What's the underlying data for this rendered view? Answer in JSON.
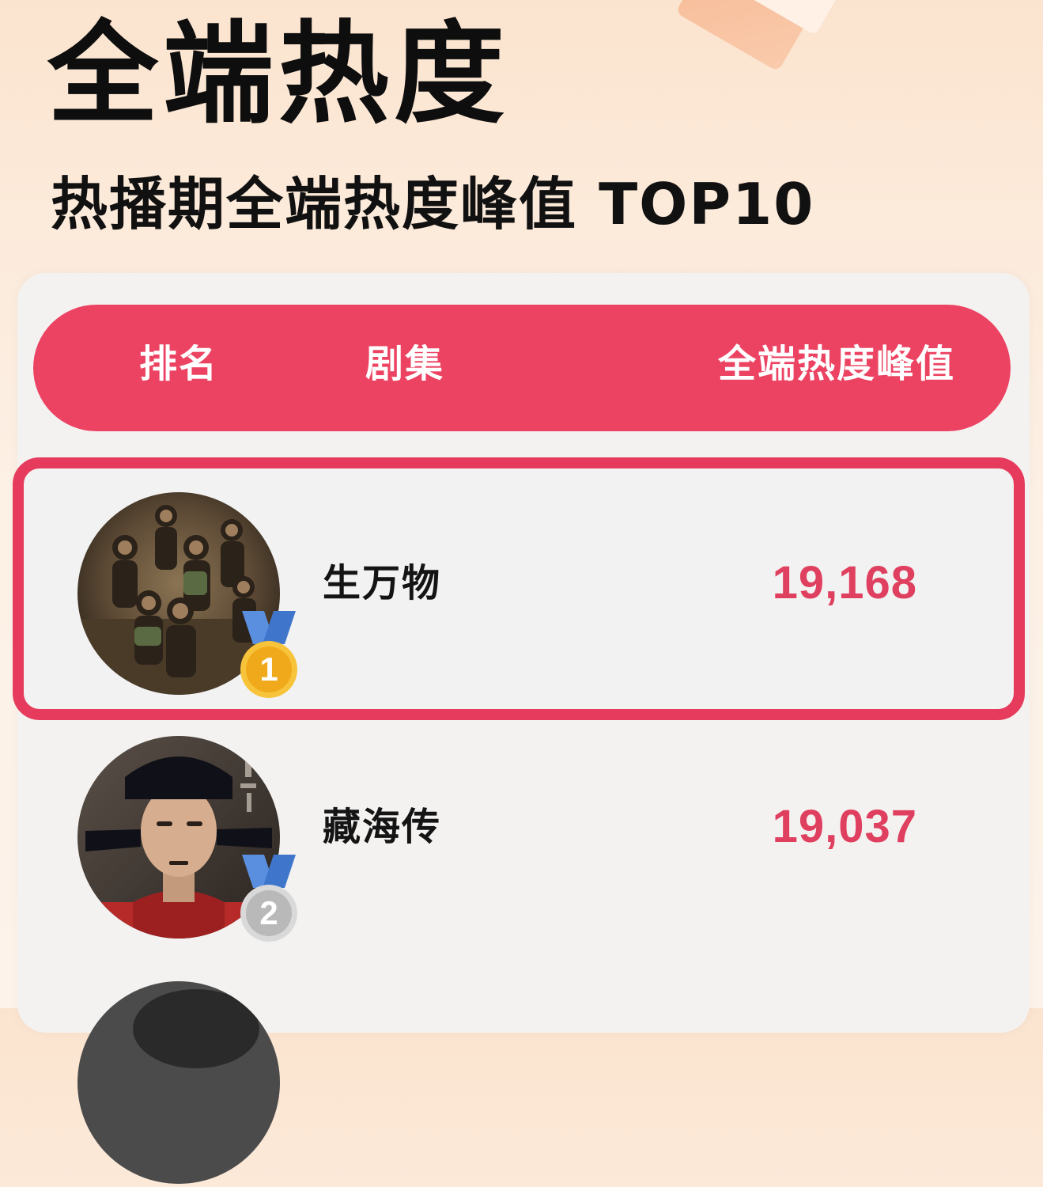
{
  "page": {
    "title": "全端热度",
    "subtitle": "热播期全端热度峰值  TOP10"
  },
  "table": {
    "headers": {
      "rank": "排名",
      "show": "剧集",
      "heat": "全端热度峰值"
    },
    "rows": [
      {
        "rank": "1",
        "title": "生万物",
        "value": "19,168",
        "medal": "gold-medal-icon",
        "highlighted": true
      },
      {
        "rank": "2",
        "title": "藏海传",
        "value": "19,037",
        "medal": "silver-medal-icon",
        "highlighted": false
      }
    ]
  },
  "colors": {
    "accent": "#ec4363",
    "value": "#e0405f",
    "gold": "#f0a91a",
    "silver": "#b9b9b9",
    "ribbon": "#5a8fe0"
  }
}
